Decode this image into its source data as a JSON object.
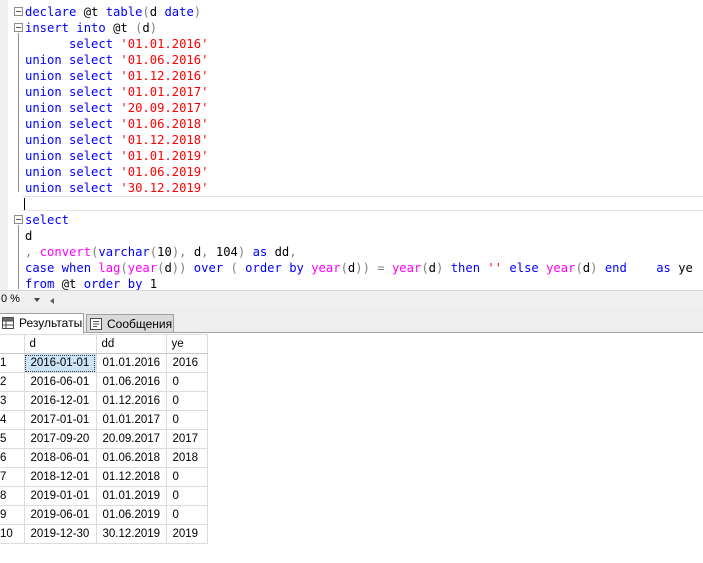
{
  "editor": {
    "lines": [
      [
        {
          "t": "declare ",
          "c": "kw"
        },
        {
          "t": "@t ",
          "c": ""
        },
        {
          "t": "table",
          "c": "kw"
        },
        {
          "t": "(",
          "c": "op"
        },
        {
          "t": "d ",
          "c": ""
        },
        {
          "t": "date",
          "c": "kw"
        },
        {
          "t": ")",
          "c": "op"
        }
      ],
      [
        {
          "t": "insert into ",
          "c": "kw"
        },
        {
          "t": "@t ",
          "c": ""
        },
        {
          "t": "(",
          "c": "op"
        },
        {
          "t": "d",
          "c": ""
        },
        {
          "t": ")",
          "c": "op"
        }
      ],
      [
        {
          "t": "      select ",
          "c": "kw"
        },
        {
          "t": "'01.01.2016'",
          "c": "str"
        }
      ],
      [
        {
          "t": "union select ",
          "c": "kw"
        },
        {
          "t": "'01.06.2016'",
          "c": "str"
        }
      ],
      [
        {
          "t": "union select ",
          "c": "kw"
        },
        {
          "t": "'01.12.2016'",
          "c": "str"
        }
      ],
      [
        {
          "t": "union select ",
          "c": "kw"
        },
        {
          "t": "'01.01.2017'",
          "c": "str"
        }
      ],
      [
        {
          "t": "union select ",
          "c": "kw"
        },
        {
          "t": "'20.09.2017'",
          "c": "str"
        }
      ],
      [
        {
          "t": "union select ",
          "c": "kw"
        },
        {
          "t": "'01.06.2018'",
          "c": "str"
        }
      ],
      [
        {
          "t": "union select ",
          "c": "kw"
        },
        {
          "t": "'01.12.2018'",
          "c": "str"
        }
      ],
      [
        {
          "t": "union select ",
          "c": "kw"
        },
        {
          "t": "'01.01.2019'",
          "c": "str"
        }
      ],
      [
        {
          "t": "union select ",
          "c": "kw"
        },
        {
          "t": "'01.06.2019'",
          "c": "str"
        }
      ],
      [
        {
          "t": "union select ",
          "c": "kw"
        },
        {
          "t": "'30.12.2019'",
          "c": "str"
        }
      ],
      [],
      [
        {
          "t": "select",
          "c": "kw"
        }
      ],
      [
        {
          "t": "d",
          "c": ""
        }
      ],
      [
        {
          "t": ", ",
          "c": "op"
        },
        {
          "t": "convert",
          "c": "fn"
        },
        {
          "t": "(",
          "c": "op"
        },
        {
          "t": "varchar",
          "c": "kw"
        },
        {
          "t": "(",
          "c": "op"
        },
        {
          "t": "10",
          "c": ""
        },
        {
          "t": "), ",
          "c": "op"
        },
        {
          "t": "d",
          "c": ""
        },
        {
          "t": ", ",
          "c": "op"
        },
        {
          "t": "104",
          "c": ""
        },
        {
          "t": ") ",
          "c": "op"
        },
        {
          "t": "as ",
          "c": "kw"
        },
        {
          "t": "dd",
          "c": ""
        },
        {
          "t": ",",
          "c": "op"
        }
      ],
      [
        {
          "t": "case when ",
          "c": "kw"
        },
        {
          "t": "lag",
          "c": "fn"
        },
        {
          "t": "(",
          "c": "op"
        },
        {
          "t": "year",
          "c": "fn"
        },
        {
          "t": "(",
          "c": "op"
        },
        {
          "t": "d",
          "c": ""
        },
        {
          "t": ")) ",
          "c": "op"
        },
        {
          "t": "over ",
          "c": "kw"
        },
        {
          "t": "( ",
          "c": "op"
        },
        {
          "t": "order by ",
          "c": "kw"
        },
        {
          "t": "year",
          "c": "fn"
        },
        {
          "t": "(",
          "c": "op"
        },
        {
          "t": "d",
          "c": ""
        },
        {
          "t": ")) = ",
          "c": "op"
        },
        {
          "t": "year",
          "c": "fn"
        },
        {
          "t": "(",
          "c": "op"
        },
        {
          "t": "d",
          "c": ""
        },
        {
          "t": ") ",
          "c": "op"
        },
        {
          "t": "then ",
          "c": "kw"
        },
        {
          "t": "'' ",
          "c": "str"
        },
        {
          "t": "else ",
          "c": "kw"
        },
        {
          "t": "year",
          "c": "fn"
        },
        {
          "t": "(",
          "c": "op"
        },
        {
          "t": "d",
          "c": ""
        },
        {
          "t": ") ",
          "c": "op"
        },
        {
          "t": "end    ",
          "c": "kw"
        },
        {
          "t": "as ",
          "c": "kw"
        },
        {
          "t": "ye",
          "c": ""
        }
      ],
      [
        {
          "t": "from ",
          "c": "kw"
        },
        {
          "t": "@t ",
          "c": ""
        },
        {
          "t": "order by ",
          "c": "kw"
        },
        {
          "t": "1",
          "c": ""
        }
      ]
    ]
  },
  "zoom": {
    "value": "0 %"
  },
  "tabs": {
    "results_label": "Результаты",
    "messages_label": "Сообщения",
    "results_icon": "grid-icon",
    "messages_icon": "message-icon"
  },
  "grid": {
    "columns": [
      "d",
      "dd",
      "ye"
    ],
    "rows": [
      [
        "1",
        "2016-01-01",
        "01.01.2016",
        "2016"
      ],
      [
        "2",
        "2016-06-01",
        "01.06.2016",
        "0"
      ],
      [
        "3",
        "2016-12-01",
        "01.12.2016",
        "0"
      ],
      [
        "4",
        "2017-01-01",
        "01.01.2017",
        "0"
      ],
      [
        "5",
        "2017-09-20",
        "20.09.2017",
        "2017"
      ],
      [
        "6",
        "2018-06-01",
        "01.06.2018",
        "2018"
      ],
      [
        "7",
        "2018-12-01",
        "01.12.2018",
        "0"
      ],
      [
        "8",
        "2019-01-01",
        "01.01.2019",
        "0"
      ],
      [
        "9",
        "2019-06-01",
        "01.06.2019",
        "0"
      ],
      [
        "10",
        "2019-12-30",
        "30.12.2019",
        "2019"
      ]
    ]
  }
}
